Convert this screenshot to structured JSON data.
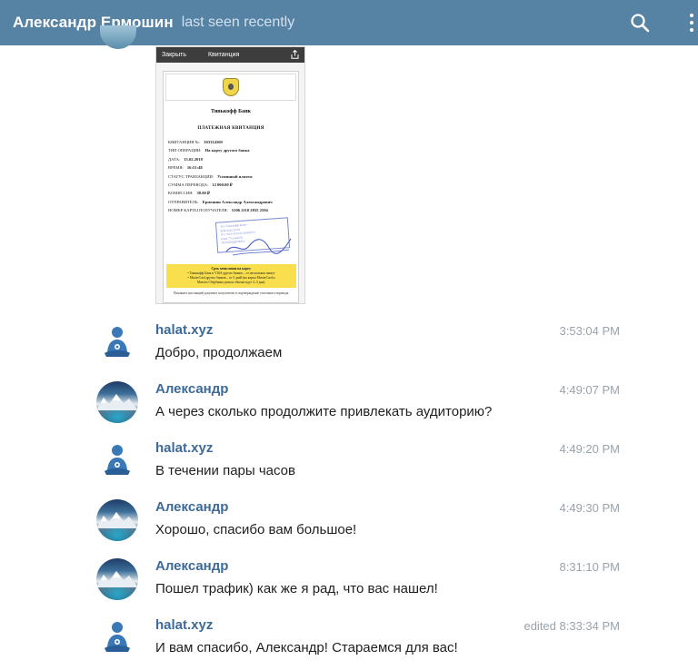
{
  "header": {
    "contact_name": "Александр Ермошин",
    "status": "last seen recently"
  },
  "receipt": {
    "close_label": "Закрыть",
    "title": "Квитанция",
    "bank_name": "Тинькофф Банк",
    "doc_title": "ПЛАТЕЖНАЯ КВИТАНЦИЯ",
    "fields": [
      {
        "label": "КВИТАНЦИЯ №:",
        "value": "393314569"
      },
      {
        "label": "ТИП ОПЕРАЦИИ:",
        "value": "На карту другого банка"
      },
      {
        "label": "ДАТА:",
        "value": "15.02.2018"
      },
      {
        "label": "ВРЕМЯ:",
        "value": "16:51:48"
      },
      {
        "label": "СТАТУС ТРАНЗАКЦИИ:",
        "value": "Успешный платеж"
      },
      {
        "label": "СУММА ПЕРЕВОДА:",
        "value": "12 000.00 ₽"
      },
      {
        "label": "КОМИССИЯ:",
        "value": "38.00 ₽"
      },
      {
        "label": "ОТПРАВИТЕЛЬ:",
        "value": "Ермошин Александр Александрович"
      },
      {
        "label": "НОМЕР КАРТЫ ПОЛУЧАТЕЛЯ:",
        "value": "5106 2110 2835 2594"
      }
    ],
    "stamp_lines": [
      "АО «Тинькофф Банк»",
      "БИК 044525974",
      "К/С 30101810145250000974",
      "ИНН 7710140679",
      "ТЕХПОДДЕРЖКА"
    ],
    "note_title": "Срок зачисления на карту:",
    "note_lines": [
      "• Тинькофф Банк и VISA других банков – от нескольких минут",
      "• MasterCard других банков – от 5 дней (на карты MasterCard и",
      "Maestro Сбербанка деньги обычно идут 2–3 дня)."
    ],
    "footer_note": "Покажите настоящий документ получателю в подтверждение успешного перевода."
  },
  "messages": [
    {
      "sender": "halat.xyz",
      "avatar": "bot-avatar",
      "time": "3:53:04 PM",
      "text": "Добро, продолжаем"
    },
    {
      "sender": "Александр",
      "avatar": "photo-avatar",
      "time": "4:49:07 PM",
      "text": "А через сколько продолжите привлекать аудиторию?"
    },
    {
      "sender": "halat.xyz",
      "avatar": "bot-avatar",
      "time": "4:49:20 PM",
      "text": "В течении пары часов"
    },
    {
      "sender": "Александр",
      "avatar": "photo-avatar",
      "time": "4:49:30 PM",
      "text": "Хорошо, спасибо вам большое!"
    },
    {
      "sender": "Александр",
      "avatar": "photo-avatar",
      "time": "8:31:10 PM",
      "text": "Пошел трафик) как же я рад, что вас нашел!"
    },
    {
      "sender": "halat.xyz",
      "avatar": "bot-avatar",
      "time": "edited 8:33:34 PM",
      "text": "И вам спасибо, Александр! Стараемся для вас!"
    }
  ],
  "colors": {
    "header_bg": "#5682a3",
    "sender_name": "#3d6a98",
    "timestamp": "#9aa3ab",
    "bot_avatar": "#3a78b8"
  },
  "icons": [
    "search-icon",
    "more-vertical-icon",
    "share-icon"
  ]
}
